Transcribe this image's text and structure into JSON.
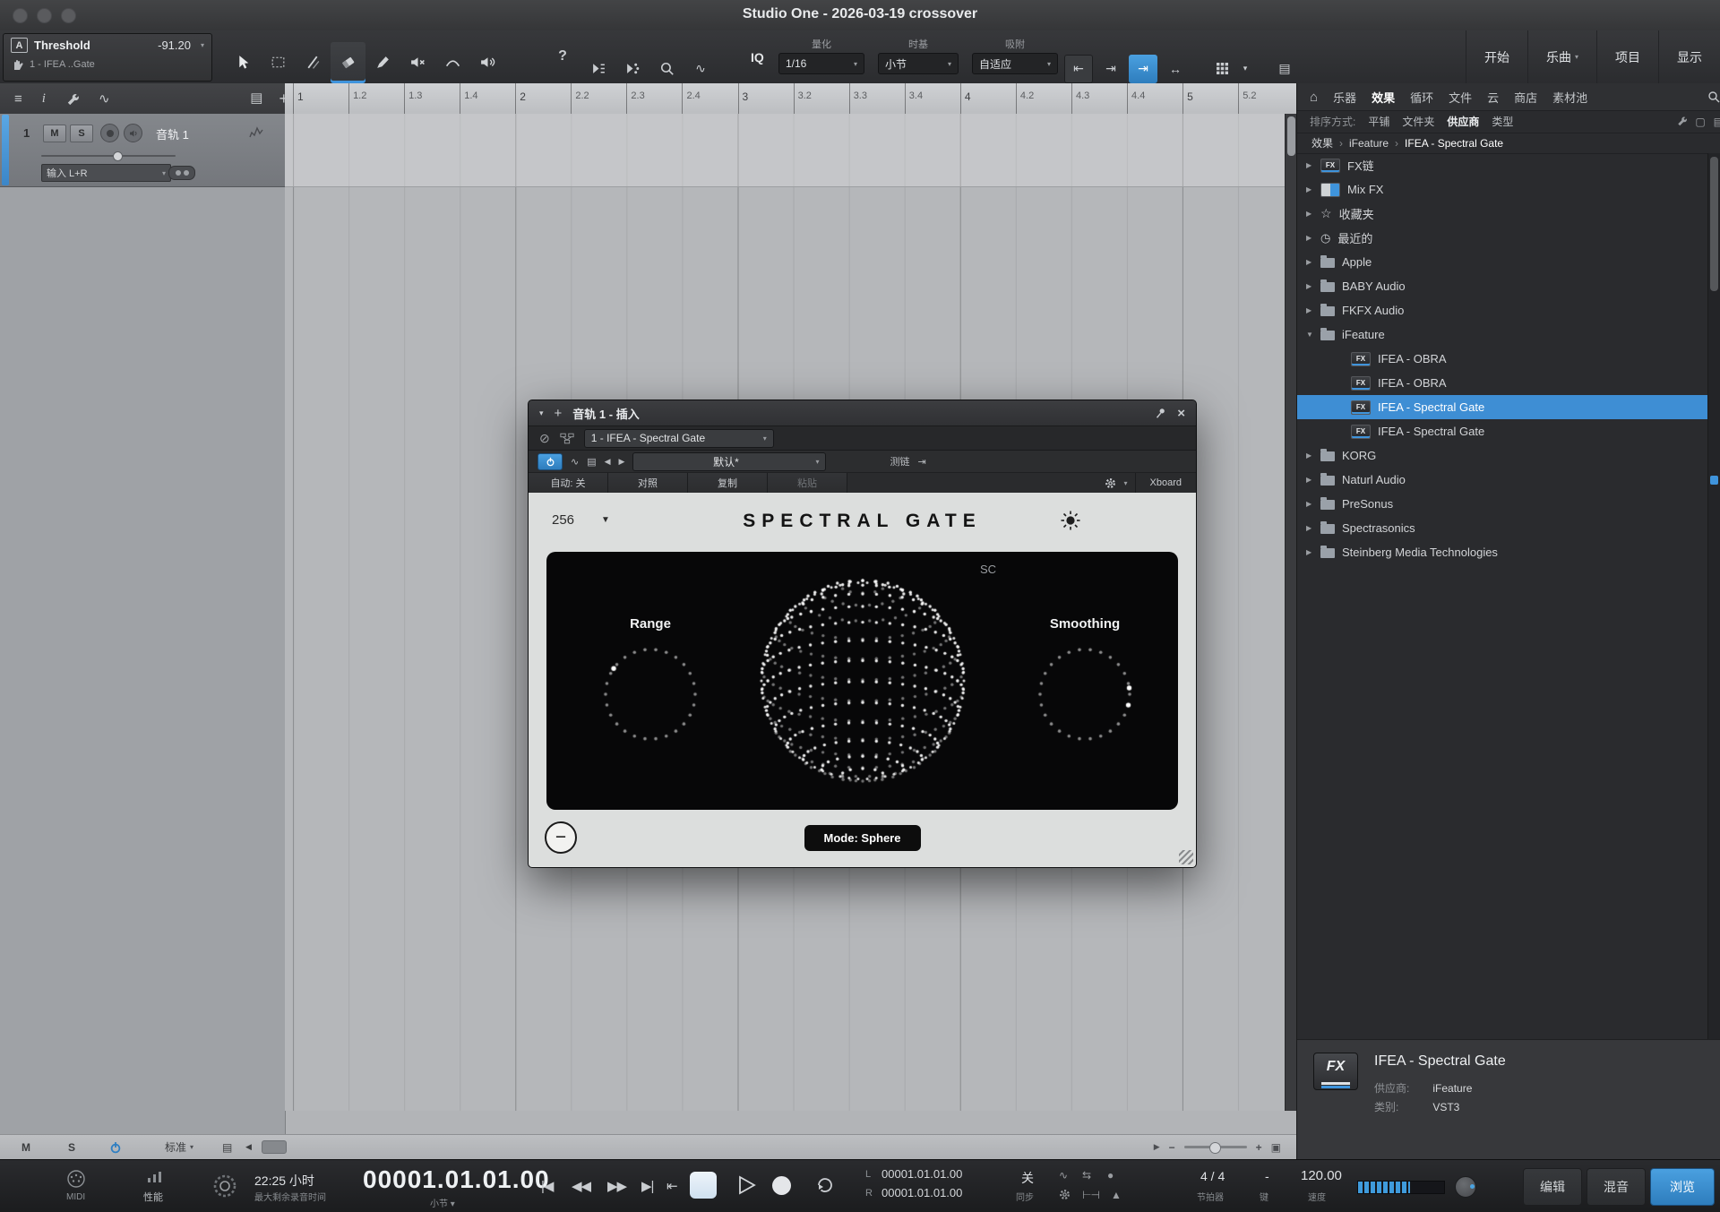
{
  "titlebar": {
    "title": "Studio One - 2026-03-19 crossover"
  },
  "toolbar": {
    "mode_letter": "A",
    "track_name": "Threshold",
    "track_sub": "1 - IFEA ..Gate",
    "track_value": "-91.20",
    "help": "?",
    "iq": "IQ",
    "quantize_label": "量化",
    "quantize_value": "1/16",
    "timebase_label": "时基",
    "timebase_value": "小节",
    "snap_label": "吸附",
    "snap_value": "自适应",
    "start": "开始",
    "song": "乐曲",
    "project": "项目",
    "show": "显示"
  },
  "tracklist": {
    "number": "1",
    "mute": "M",
    "solo": "S",
    "name": "音轨 1",
    "input": "输入 L+R",
    "footer_mute": "M",
    "footer_solo": "S",
    "footer_mode": "标准"
  },
  "ruler": {
    "ticks": [
      "1",
      "1.2",
      "1.3",
      "1.4",
      "2",
      "2.2",
      "2.3",
      "2.4",
      "3",
      "3.2",
      "3.3",
      "3.4",
      "4",
      "4.2",
      "4.3",
      "4.4",
      "5",
      "5.2"
    ]
  },
  "browser": {
    "tabs": [
      "乐器",
      "效果",
      "循环",
      "文件",
      "云",
      "商店",
      "素材池"
    ],
    "active_tab": "效果",
    "sort_label": "排序方式:",
    "sort_options": [
      "平铺",
      "文件夹",
      "供应商",
      "类型"
    ],
    "active_sort": "供应商",
    "breadcrumb": [
      "效果",
      "iFeature",
      "IFEA - Spectral Gate"
    ],
    "tree": [
      {
        "label": "FX链",
        "icon": "fx",
        "expandable": true
      },
      {
        "label": "Mix FX",
        "icon": "mixfx",
        "expandable": true
      },
      {
        "label": "收藏夹",
        "icon": "star",
        "expandable": true
      },
      {
        "label": "最近的",
        "icon": "clock",
        "expandable": true
      },
      {
        "label": "Apple",
        "icon": "folder",
        "expandable": true
      },
      {
        "label": "BABY Audio",
        "icon": "folder",
        "expandable": true
      },
      {
        "label": "FKFX Audio",
        "icon": "folder",
        "expandable": true
      },
      {
        "label": "iFeature",
        "icon": "folder",
        "expandable": true,
        "expanded": true
      },
      {
        "label": "IFEA - OBRA",
        "icon": "fx",
        "child": true
      },
      {
        "label": "IFEA - OBRA",
        "icon": "fx",
        "child": true
      },
      {
        "label": "IFEA - Spectral Gate",
        "icon": "fx",
        "child": true,
        "selected": true
      },
      {
        "label": "IFEA - Spectral Gate",
        "icon": "fx",
        "child": true
      },
      {
        "label": "KORG",
        "icon": "folder",
        "expandable": true
      },
      {
        "label": "Naturl Audio",
        "icon": "folder",
        "expandable": true
      },
      {
        "label": "PreSonus",
        "icon": "folder",
        "expandable": true
      },
      {
        "label": "Spectrasonics",
        "icon": "folder",
        "expandable": true
      },
      {
        "label": "Steinberg Media Technologies",
        "icon": "folder",
        "expandable": true
      }
    ],
    "detail_badge": "FX",
    "detail_title": "IFEA - Spectral Gate",
    "vendor_label": "供应商:",
    "vendor": "iFeature",
    "category_label": "类别:",
    "category": "VST3"
  },
  "plugin": {
    "window_title": "音轨 1 - 插入",
    "slot": "1 - IFEA - Spectral Gate",
    "preset": "默认*",
    "auto": "自动: 关",
    "compare": "对照",
    "copy": "复制",
    "paste": "粘贴",
    "sidechain": "测链",
    "xboard": "Xboard",
    "fft": "256",
    "title": "SPECTRAL GATE",
    "sc": "SC",
    "range": "Range",
    "smoothing": "Smoothing",
    "mode": "Mode: Sphere"
  },
  "transport": {
    "midi": "MIDI",
    "performance": "性能",
    "remaining": "22:25 小时",
    "remaining_label": "最大剩余录音时间",
    "time": "00001.01.01.00",
    "time_unit": "小节",
    "l": "L",
    "r": "R",
    "loop_start": "00001.01.01.00",
    "loop_end": "00001.01.01.00",
    "off": "关",
    "sync": "同步",
    "signature": "4 / 4",
    "signature_label": "节拍器",
    "key": "-",
    "key_label": "键",
    "tempo": "120.00",
    "tempo_label": "速度",
    "buttons": [
      "编辑",
      "混音",
      "浏览"
    ],
    "active_button": "浏览"
  }
}
